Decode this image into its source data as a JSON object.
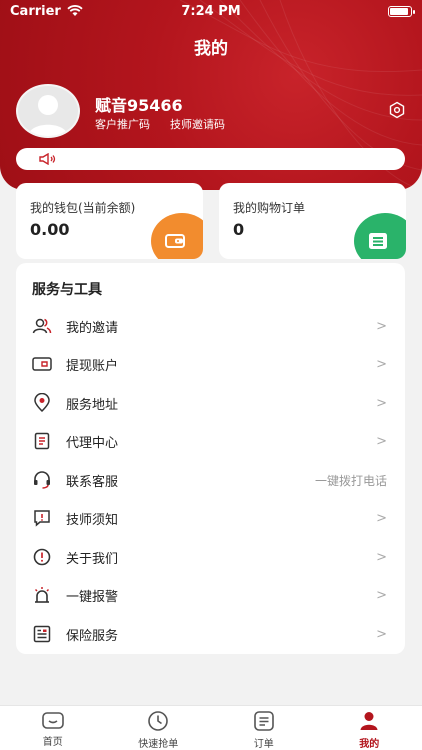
{
  "status_bar": {
    "carrier": "Carrier",
    "time": "7:24 PM"
  },
  "header": {
    "title": "我的"
  },
  "profile": {
    "username": "赋音95466",
    "links": [
      "客户推广码",
      "技师邀请码"
    ]
  },
  "notice": {
    "text": ""
  },
  "cards": [
    {
      "label": "我的钱包(当前余额)",
      "value": "0.00",
      "icon": "wallet-icon"
    },
    {
      "label": "我的购物订单",
      "value": "0",
      "icon": "order-list-icon"
    }
  ],
  "services": {
    "title": "服务与工具",
    "items": [
      {
        "label": "我的邀请",
        "icon": "users-icon",
        "extra": ""
      },
      {
        "label": "提现账户",
        "icon": "card-icon",
        "extra": ""
      },
      {
        "label": "服务地址",
        "icon": "location-icon",
        "extra": ""
      },
      {
        "label": "代理中心",
        "icon": "document-icon",
        "extra": ""
      },
      {
        "label": "联系客服",
        "icon": "headset-icon",
        "extra": "一键拨打电话"
      },
      {
        "label": "技师须知",
        "icon": "notice-icon",
        "extra": ""
      },
      {
        "label": "关于我们",
        "icon": "info-icon",
        "extra": ""
      },
      {
        "label": "一键报警",
        "icon": "alarm-icon",
        "extra": ""
      },
      {
        "label": "保险服务",
        "icon": "insurance-icon",
        "extra": ""
      }
    ]
  },
  "tabs": [
    {
      "label": "首页",
      "icon": "home-icon",
      "active": false
    },
    {
      "label": "快速抢单",
      "icon": "clock-icon",
      "active": false
    },
    {
      "label": "订单",
      "icon": "orders-icon",
      "active": false
    },
    {
      "label": "我的",
      "icon": "profile-icon",
      "active": true
    }
  ],
  "colors": {
    "brand_red": "#b3151d",
    "wallet_orange": "#f28c2e",
    "order_green": "#2ab36a"
  }
}
